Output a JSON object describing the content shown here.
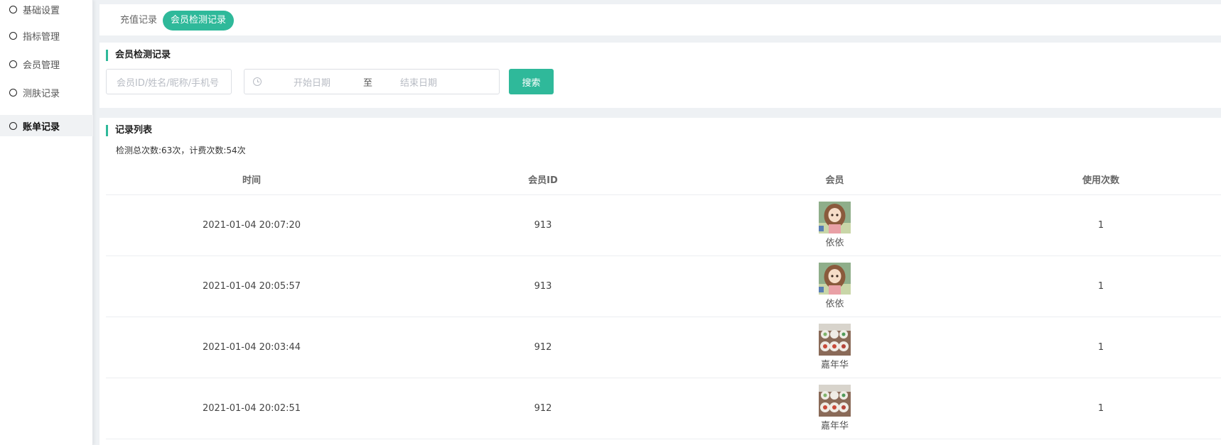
{
  "sidebar": {
    "items": [
      {
        "label": "基础设置",
        "active": false
      },
      {
        "label": "指标管理",
        "active": false
      },
      {
        "label": "会员管理",
        "active": false
      },
      {
        "label": "测肤记录",
        "active": false
      },
      {
        "label": "账单记录",
        "active": true
      }
    ]
  },
  "tabs": [
    {
      "label": "充值记录",
      "active": false
    },
    {
      "label": "会员检测记录",
      "active": true
    }
  ],
  "search": {
    "title": "会员检测记录",
    "member_placeholder": "会员ID/姓名/昵称/手机号",
    "start_placeholder": "开始日期",
    "range_separator": "至",
    "end_placeholder": "结束日期",
    "search_label": "搜索"
  },
  "list": {
    "title": "记录列表",
    "summary": "检测总次数:63次，计费次数:54次",
    "columns": [
      "时间",
      "会员ID",
      "会员",
      "使用次数"
    ],
    "rows": [
      {
        "time": "2021-01-04 20:07:20",
        "member_id": "913",
        "member_name": "依依",
        "avatar": "girl-avatar",
        "count": "1"
      },
      {
        "time": "2021-01-04 20:05:57",
        "member_id": "913",
        "member_name": "依依",
        "avatar": "girl-avatar",
        "count": "1"
      },
      {
        "time": "2021-01-04 20:03:44",
        "member_id": "912",
        "member_name": "嘉年华",
        "avatar": "cups-avatar",
        "count": "1"
      },
      {
        "time": "2021-01-04 20:02:51",
        "member_id": "912",
        "member_name": "嘉年华",
        "avatar": "cups-avatar",
        "count": "1"
      }
    ]
  },
  "colors": {
    "accent": "#2fb99a",
    "background": "#eef1f4"
  }
}
